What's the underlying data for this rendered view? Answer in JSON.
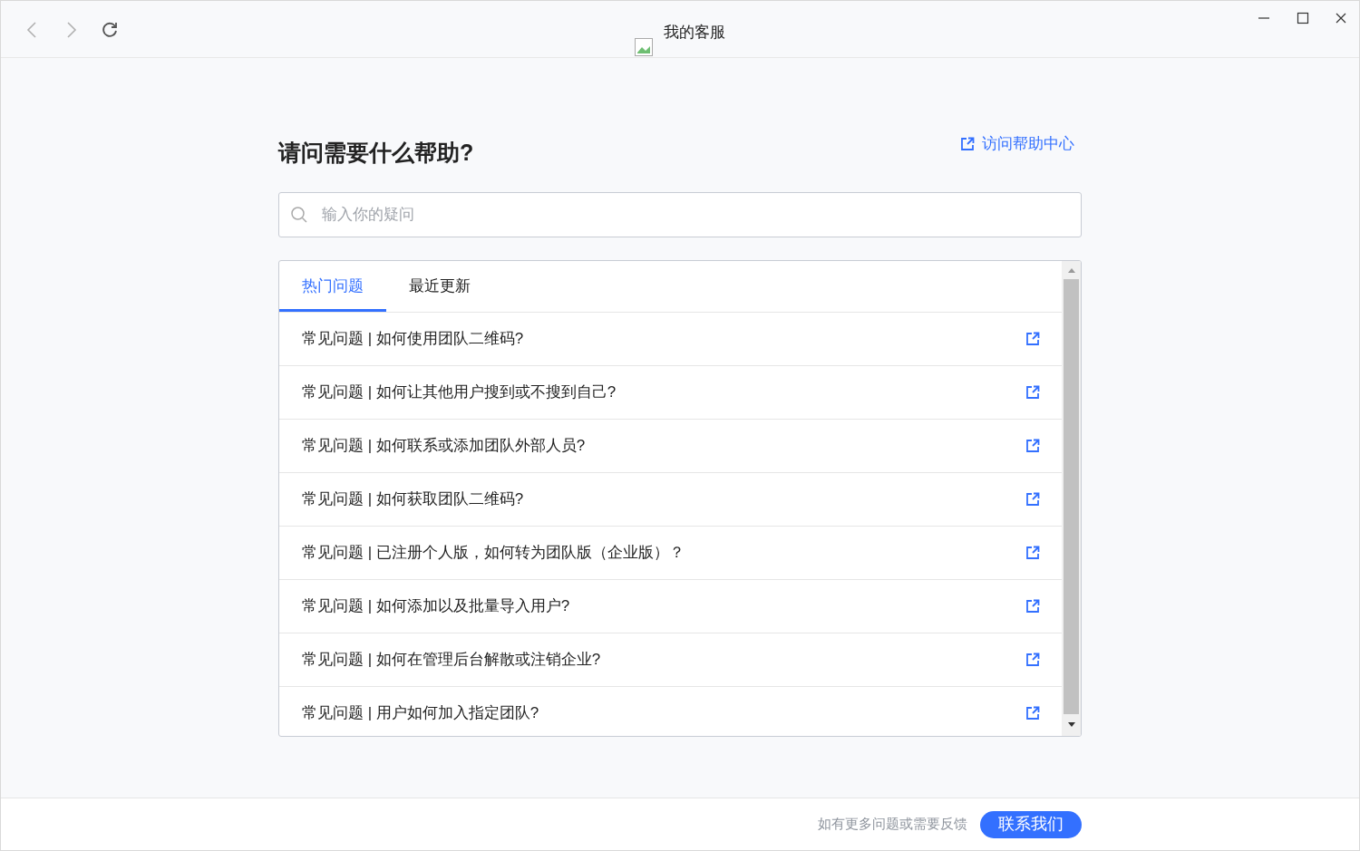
{
  "window": {
    "title": "我的客服"
  },
  "heading": "请问需要什么帮助?",
  "help_link": "访问帮助中心",
  "search": {
    "placeholder": "输入你的疑问"
  },
  "tabs": [
    {
      "label": "热门问题",
      "selected": true
    },
    {
      "label": "最近更新",
      "selected": false
    }
  ],
  "questions": [
    "常见问题 | 如何使用团队二维码?",
    "常见问题 | 如何让其他用户搜到或不搜到自己?",
    "常见问题 | 如何联系或添加团队外部人员?",
    "常见问题 | 如何获取团队二维码?",
    "常见问题 | 已注册个人版，如何转为团队版（企业版）？",
    "常见问题 | 如何添加以及批量导入用户?",
    "常见问题 | 如何在管理后台解散或注销企业?",
    "常见问题 | 用户如何加入指定团队?"
  ],
  "footer": {
    "note": "如有更多问题或需要反馈",
    "button": "联系我们"
  }
}
